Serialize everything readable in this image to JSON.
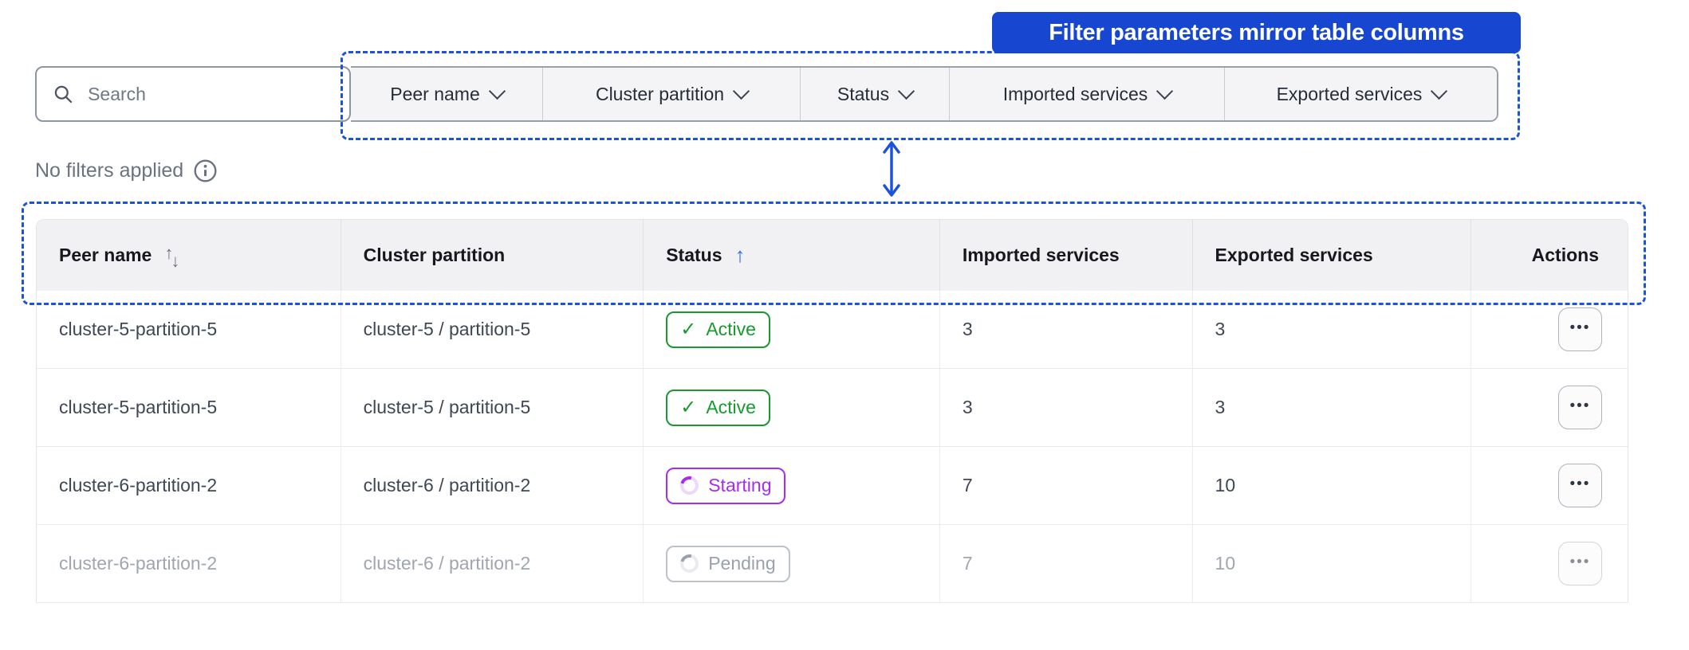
{
  "callout": {
    "label": "Filter parameters mirror table columns"
  },
  "toolbar": {
    "search_placeholder": "Search",
    "filters": [
      {
        "label": "Peer name"
      },
      {
        "label": "Cluster partition"
      },
      {
        "label": "Status"
      },
      {
        "label": "Imported services"
      },
      {
        "label": "Exported services"
      }
    ]
  },
  "filter_summary": {
    "text": "No filters applied"
  },
  "table": {
    "columns": [
      {
        "label": "Peer name",
        "sort": "both"
      },
      {
        "label": "Cluster partition",
        "sort": "none"
      },
      {
        "label": "Status",
        "sort": "asc"
      },
      {
        "label": "Imported services",
        "sort": "none"
      },
      {
        "label": "Exported services",
        "sort": "none"
      },
      {
        "label": "Actions",
        "sort": "none"
      }
    ],
    "rows": [
      {
        "peer_name": "cluster-5-partition-5",
        "cluster_partition": "cluster-5 / partition-5",
        "status": "Active",
        "status_kind": "active",
        "imported": "3",
        "exported": "3",
        "muted": false
      },
      {
        "peer_name": "cluster-5-partition-5",
        "cluster_partition": "cluster-5 / partition-5",
        "status": "Active",
        "status_kind": "active",
        "imported": "3",
        "exported": "3",
        "muted": false
      },
      {
        "peer_name": "cluster-6-partition-2",
        "cluster_partition": "cluster-6 / partition-2",
        "status": "Starting",
        "status_kind": "starting",
        "imported": "7",
        "exported": "10",
        "muted": false
      },
      {
        "peer_name": "cluster-6-partition-2",
        "cluster_partition": "cluster-6 / partition-2",
        "status": "Pending",
        "status_kind": "pending",
        "imported": "7",
        "exported": "10",
        "muted": true
      }
    ],
    "actions_menu_icon": "•••"
  },
  "icons": {
    "search": "magnifier",
    "info": "info-circle",
    "filter_chevron": "chevron-down",
    "sort_both": "↑↓",
    "sort_asc": "↑",
    "active_check": "✓",
    "status_spinner": "spinner-ring",
    "mirror_arrow": "double-headed-vertical-arrow"
  },
  "colors": {
    "callout_bg": "#1747D0",
    "annotation_blue": "#1D52DC",
    "sort_asc_blue": "#2E6BF0",
    "active_green": "#169B2E",
    "starting_purple": "#A62CF5",
    "pending_gray": "#6E7683",
    "header_bg": "#F1F1F3",
    "filter_btn_bg": "#F4F4F6"
  }
}
